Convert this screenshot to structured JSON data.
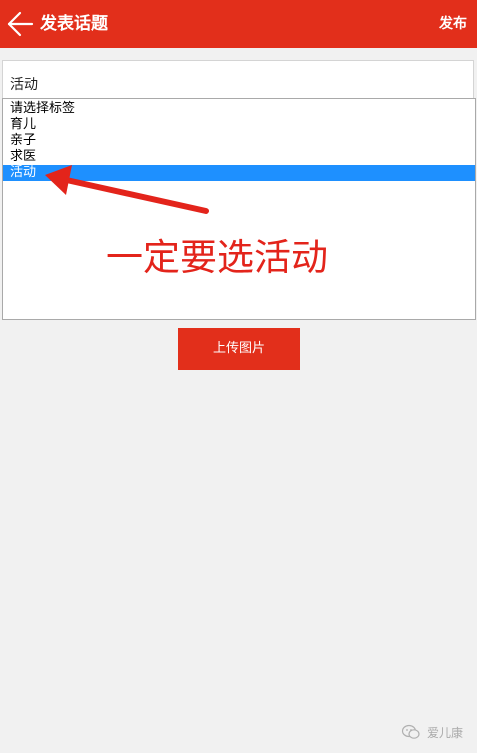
{
  "header": {
    "title": "发表话题",
    "publish_label": "发布",
    "background_color": "#e22f1b"
  },
  "topic_input": {
    "value": "活动"
  },
  "tag_select": {
    "options": [
      "请选择标签",
      "育儿",
      "亲子",
      "求医",
      "活动"
    ],
    "selected_index": 4,
    "selected_color": "#1e90ff"
  },
  "annotation": {
    "text": "一定要选活动",
    "color": "#e3241b"
  },
  "upload_button": {
    "label": "上传图片"
  },
  "watermark": {
    "text": "爱儿康"
  },
  "icons": {
    "back": "back-arrow-icon",
    "watermark": "wechat-icon"
  }
}
